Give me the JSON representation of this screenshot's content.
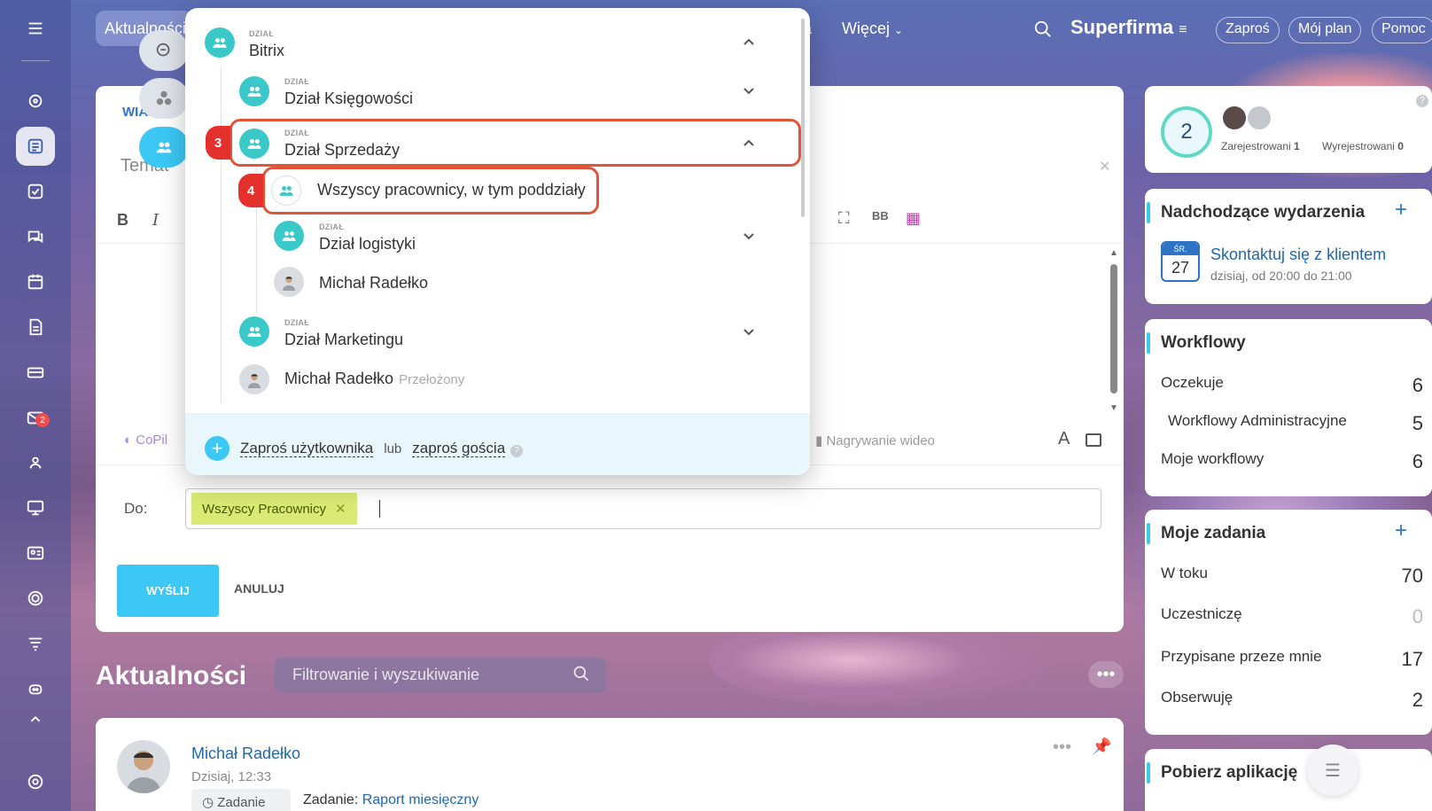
{
  "topbar": {
    "current_tab": "Aktualności",
    "partial_link": "a",
    "more_label": "Więcej",
    "brand": "Superfirma",
    "buttons": [
      "Zaproś",
      "Mój plan",
      "Pomoc"
    ]
  },
  "sidebar": {
    "mail_badge": "2"
  },
  "editor": {
    "tab_label": "WIA",
    "subject_placeholder": "Temat",
    "bold_label": "B",
    "italic_label": "I",
    "bbcode_label": "BB",
    "copilot_label": "CoPil",
    "video_label": "Nagrywanie wideo",
    "text_format_label": "A",
    "to_label": "Do:",
    "recipient_chip": "Wszyscy Pracownicy",
    "send_label": "WYŚLIJ",
    "cancel_label": "ANULUJ"
  },
  "dropdown": {
    "items": [
      {
        "kind": "DZIAŁ",
        "name": "Bitrix"
      },
      {
        "kind": "DZIAŁ",
        "name": "Dział Księgowości"
      },
      {
        "kind": "DZIAŁ",
        "name": "Dział Sprzedaży"
      },
      {
        "kind": "",
        "name": "Wszyscy pracownicy, w tym poddziały"
      },
      {
        "kind": "DZIAŁ",
        "name": "Dział logistyki"
      },
      {
        "kind": "",
        "name": "Michał Radełko"
      },
      {
        "kind": "DZIAŁ",
        "name": "Dział Marketingu"
      },
      {
        "kind": "",
        "name": "Michał Radełko",
        "sub": "Przełożony"
      }
    ],
    "step_badges": [
      "3",
      "4"
    ],
    "footer": {
      "invite_user": "Zaproś użytkownika",
      "or": "lub",
      "invite_guest": "zaproś gościa",
      "help": "?"
    }
  },
  "news": {
    "title": "Aktualności",
    "filter_placeholder": "Filtrowanie i wyszukiwanie",
    "more": "•••"
  },
  "post": {
    "author": "Michał Radełko",
    "time": "Dzisiaj, 12:33",
    "tag": "Zadanie",
    "task_prefix": "Zadanie:",
    "task_link": "Raport miesięczny"
  },
  "widgets": {
    "attendance": {
      "count": "2",
      "registered_label": "Zarejestrowani",
      "registered": "1",
      "unregistered_label": "Wyrejestrowani",
      "unregistered": "0"
    },
    "events": {
      "title": "Nadchodzące wydarzenia",
      "day_of_week": "ŚR.",
      "day": "27",
      "event_title": "Skontaktuj się z klientem",
      "event_time": "dzisiaj, od 20:00 do 21:00"
    },
    "workflows": {
      "title": "Workflowy",
      "rows": [
        {
          "label": "Oczekuje",
          "value": "6"
        },
        {
          "label": "Workflowy Administracyjne",
          "value": "5"
        },
        {
          "label": "Moje workflowy",
          "value": "6"
        }
      ]
    },
    "tasks": {
      "title": "Moje zadania",
      "rows": [
        {
          "label": "W toku",
          "value": "70"
        },
        {
          "label": "Uczestniczę",
          "value": "0"
        },
        {
          "label": "Przypisane przeze mnie",
          "value": "17"
        },
        {
          "label": "Obserwuję",
          "value": "2"
        }
      ]
    },
    "app": {
      "title": "Pobierz aplikację"
    }
  },
  "colors": {
    "accent": "#3bc8f5",
    "link": "#2067b0",
    "highlight": "#e0553a",
    "chip": "#d8ea74",
    "dept_avatar": "#3bc8c8"
  }
}
